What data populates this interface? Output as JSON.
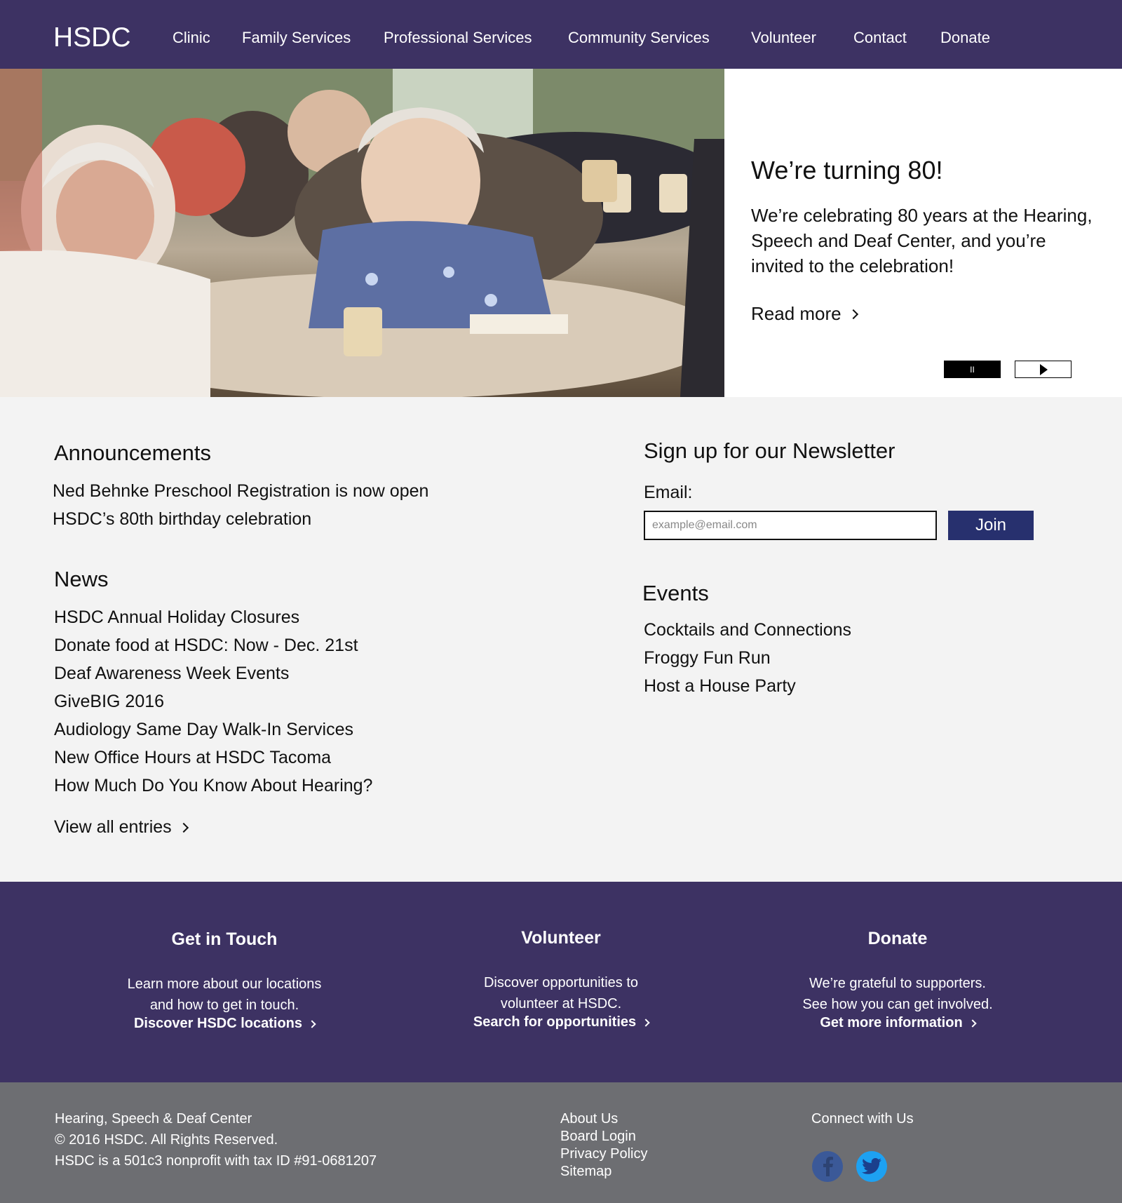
{
  "header": {
    "logo": "HSDC",
    "nav": [
      "Clinic",
      "Family Services",
      "Professional Services",
      "Community Services",
      "Volunteer",
      "Contact",
      "Donate"
    ]
  },
  "hero": {
    "title": "We’re turning 80!",
    "text": "We’re celebrating 80 years at the Hearing, Speech and Deaf Center, and you’re invited to the celebration!",
    "read_more": "Read more",
    "pause_label": "II"
  },
  "announcements": {
    "heading": "Announcements",
    "items": [
      "Ned Behnke Preschool Registration is now open",
      "HSDC’s 80th birthday celebration"
    ]
  },
  "news": {
    "heading": "News",
    "items": [
      "HSDC Annual Holiday Closures",
      "Donate food at HSDC: Now - Dec. 21st",
      "Deaf Awareness Week Events",
      "GiveBIG 2016",
      "Audiology Same Day Walk-In Services",
      "New Office Hours at HSDC Tacoma",
      "How Much Do You Know About Hearing?"
    ],
    "view_all": "View all entries"
  },
  "newsletter": {
    "heading": "Sign up for our Newsletter",
    "email_label": "Email:",
    "placeholder": "example@email.com",
    "join": "Join"
  },
  "events": {
    "heading": "Events",
    "items": [
      "Cocktails and Connections",
      "Froggy Fun Run",
      "Host a House Party"
    ]
  },
  "cta": {
    "touch": {
      "title": "Get in Touch",
      "line1": "Learn more about our locations",
      "line2": "and how to get in touch.",
      "link": "Discover HSDC locations"
    },
    "volunteer": {
      "title": "Volunteer",
      "line1": "Discover opportunities to",
      "line2": "volunteer at HSDC.",
      "link": "Search for opportunities"
    },
    "donate": {
      "title": "Donate",
      "line1": "We’re grateful to supporters.",
      "line2": "See how you can get involved.",
      "link": "Get more information"
    }
  },
  "footer": {
    "org": "Hearing, Speech & Deaf Center",
    "copyright": "© 2016 HSDC. All Rights Reserved.",
    "tax": "HSDC is a 501c3 nonprofit with tax ID #91-0681207",
    "links": [
      "About Us",
      "Board Login",
      "Privacy Policy",
      "Sitemap"
    ],
    "connect": "Connect with Us",
    "facebook_color": "#3b5998",
    "twitter_color": "#1da1f2"
  }
}
